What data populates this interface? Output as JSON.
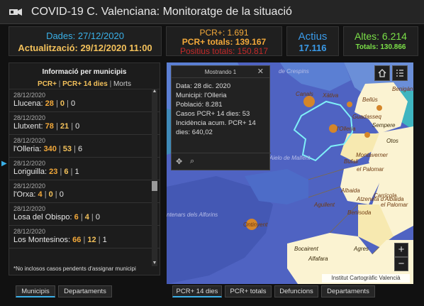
{
  "app": {
    "title": "COVID-19 C. Valenciana: Monitoratge de la situació"
  },
  "summary": {
    "dades": "Dades: 27/12/2020",
    "actualitzacio": "Actualització: 29/12/2020 11:00",
    "pcr_plus": "PCR+: 1.691",
    "pcr_totals": "PCR+ totals: 139.167",
    "positius_totals": "Positius totals: 150.817",
    "actius_label": "Actius",
    "actius_value": "17.116",
    "altes": "Altes: 6.214",
    "altes_totals": "Totals: 130.866"
  },
  "colors": {
    "accent": "#3ab0e8",
    "warning": "#f3a93a",
    "danger": "#c42a2a",
    "success": "#7be048",
    "map_blue": "#4f63c2"
  },
  "left_panel": {
    "title": "Informació per municipis",
    "subtitle_pcr": "PCR+",
    "subtitle_pcr14": "PCR+ 14 dies",
    "subtitle_morts": "Morts",
    "subtitle_sep": " | ",
    "rows": [
      {
        "date": "28/12/2020",
        "name": "Llucena:",
        "v1": "28",
        "v2": "0",
        "v3": "0"
      },
      {
        "date": "28/12/2020",
        "name": "Llutxent:",
        "v1": "78",
        "v2": "21",
        "v3": "0"
      },
      {
        "date": "28/12/2020",
        "name": "l'Olleria:",
        "v1": "340",
        "v2": "53",
        "v3": "6"
      },
      {
        "date": "28/12/2020",
        "name": "Loriguilla:",
        "v1": "23",
        "v2": "6",
        "v3": "1"
      },
      {
        "date": "28/12/2020",
        "name": "l'Orxa:",
        "v1": "4",
        "v2": "0",
        "v3": "0"
      },
      {
        "date": "28/12/2020",
        "name": "Losa del Obispo:",
        "v1": "6",
        "v2": "4",
        "v3": "0"
      },
      {
        "date": "28/12/2020",
        "name": "Los Montesinos:",
        "v1": "66",
        "v2": "12",
        "v3": "1"
      },
      {
        "date": "28/12/2020",
        "name": "",
        "v1": "",
        "v2": "",
        "v3": ""
      }
    ],
    "note": "*No inclosos casos pendents d'assignar municipi"
  },
  "popup": {
    "header": "Mostrando 1",
    "lines": [
      "Data: 28 dic. 2020",
      "Municipi: l'Olleria",
      "Població: 8.281",
      "Casos PCR+ 14 dies: 53",
      "Incidència acum. PCR+ 14",
      "dies: 640,02"
    ]
  },
  "map_labels": {
    "bellus": "Bellús",
    "xativa": "Xàtiva",
    "benigan": "Benigàn",
    "canals": "Canals",
    "crespins": "de Crespins",
    "guadasseq": "Guadasseq",
    "sempere": "Sempere",
    "olleria": "l'Olleria",
    "otos": "Otos",
    "aielo": "Aielo de Malferit",
    "montaverner": "Montaverner",
    "bufali": "Bufali",
    "palomar": "el Palomar",
    "carricola": "Carrícola",
    "albaida": "Albaida",
    "atzeneta": "Atzeneta d'Albaida",
    "palomar2": "el Palomar",
    "aguillent": "Agullent",
    "benisoda": "Benisoda",
    "ontinyent": "Ontinyent",
    "alforins": "ntenars dels Alforins",
    "bocairent": "Bocairent",
    "alfafara": "Alfafara",
    "agres": "Agres",
    "moixent": "ixent",
    "vallada": "Vallada",
    "montesa": "Montesa"
  },
  "map_controls": {
    "home": "home-icon",
    "list": "list-icon",
    "zoom_in": "+",
    "zoom_out": "−"
  },
  "attribution": "Institut Cartogràfic Valencià",
  "tabs_left": [
    "Municipis",
    "Departaments"
  ],
  "tabs_map": [
    "PCR+ 14 dies",
    "PCR+ totals",
    "Defuncions",
    "Departaments"
  ]
}
